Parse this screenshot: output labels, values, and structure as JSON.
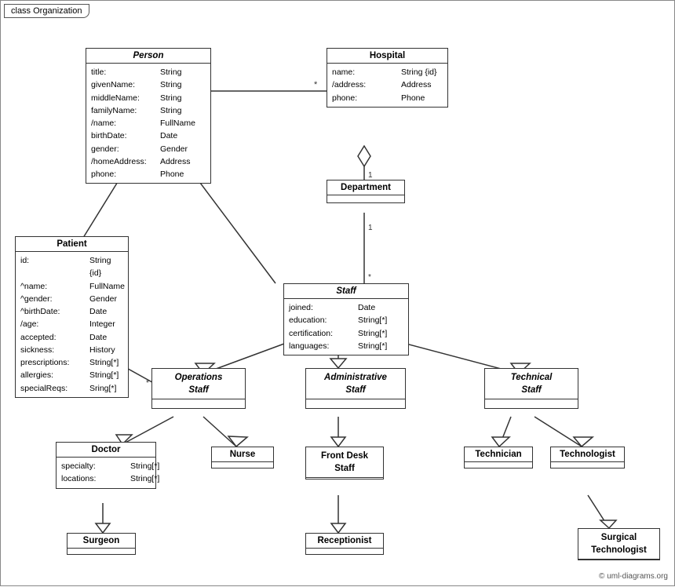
{
  "title": "class Organization",
  "copyright": "© uml-diagrams.org",
  "classes": {
    "person": {
      "title": "Person",
      "attrs": [
        {
          "name": "title:",
          "type": "String"
        },
        {
          "name": "givenName:",
          "type": "String"
        },
        {
          "name": "middleName:",
          "type": "String"
        },
        {
          "name": "familyName:",
          "type": "String"
        },
        {
          "name": "/name:",
          "type": "FullName"
        },
        {
          "name": "birthDate:",
          "type": "Date"
        },
        {
          "name": "gender:",
          "type": "Gender"
        },
        {
          "name": "/homeAddress:",
          "type": "Address"
        },
        {
          "name": "phone:",
          "type": "Phone"
        }
      ]
    },
    "hospital": {
      "title": "Hospital",
      "attrs": [
        {
          "name": "name:",
          "type": "String {id}"
        },
        {
          "name": "/address:",
          "type": "Address"
        },
        {
          "name": "phone:",
          "type": "Phone"
        }
      ]
    },
    "department": {
      "title": "Department",
      "attrs": []
    },
    "staff": {
      "title": "Staff",
      "attrs": [
        {
          "name": "joined:",
          "type": "Date"
        },
        {
          "name": "education:",
          "type": "String[*]"
        },
        {
          "name": "certification:",
          "type": "String[*]"
        },
        {
          "name": "languages:",
          "type": "String[*]"
        }
      ]
    },
    "patient": {
      "title": "Patient",
      "attrs": [
        {
          "name": "id:",
          "type": "String {id}"
        },
        {
          "name": "^name:",
          "type": "FullName"
        },
        {
          "name": "^gender:",
          "type": "Gender"
        },
        {
          "name": "^birthDate:",
          "type": "Date"
        },
        {
          "name": "/age:",
          "type": "Integer"
        },
        {
          "name": "accepted:",
          "type": "Date"
        },
        {
          "name": "sickness:",
          "type": "History"
        },
        {
          "name": "prescriptions:",
          "type": "String[*]"
        },
        {
          "name": "allergies:",
          "type": "String[*]"
        },
        {
          "name": "specialReqs:",
          "type": "Sring[*]"
        }
      ]
    },
    "operations_staff": {
      "title": "Operations\nStaff",
      "italic": true
    },
    "administrative_staff": {
      "title": "Administrative\nStaff",
      "italic": true
    },
    "technical_staff": {
      "title": "Technical\nStaff",
      "italic": true
    },
    "doctor": {
      "title": "Doctor",
      "attrs": [
        {
          "name": "specialty:",
          "type": "String[*]"
        },
        {
          "name": "locations:",
          "type": "String[*]"
        }
      ]
    },
    "nurse": {
      "title": "Nurse",
      "attrs": []
    },
    "front_desk_staff": {
      "title": "Front Desk\nStaff",
      "attrs": []
    },
    "technician": {
      "title": "Technician",
      "attrs": []
    },
    "technologist": {
      "title": "Technologist",
      "attrs": []
    },
    "surgeon": {
      "title": "Surgeon",
      "attrs": []
    },
    "receptionist": {
      "title": "Receptionist",
      "attrs": []
    },
    "surgical_technologist": {
      "title": "Surgical\nTechnologist",
      "attrs": []
    }
  },
  "multiplicity": {
    "star": "*",
    "one": "1"
  }
}
